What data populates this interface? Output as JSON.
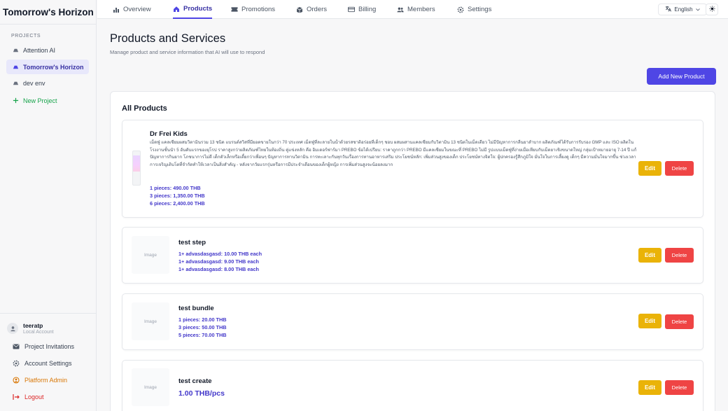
{
  "brand": "Tomorrow's Horizon",
  "sidebar": {
    "section_label": "PROJECTS",
    "projects": [
      {
        "label": "Attention AI"
      },
      {
        "label": "Tomorrow's Horizon"
      },
      {
        "label": "dev env"
      }
    ],
    "new_project": "New Project",
    "user": {
      "name": "teeratp",
      "sub": "Local Account"
    },
    "links": {
      "invitations": "Project Invitations",
      "settings": "Account Settings",
      "admin": "Platform Admin",
      "logout": "Logout"
    }
  },
  "nav": {
    "tabs": [
      {
        "label": "Overview"
      },
      {
        "label": "Products"
      },
      {
        "label": "Promotions"
      },
      {
        "label": "Orders"
      },
      {
        "label": "Billing"
      },
      {
        "label": "Members"
      },
      {
        "label": "Settings"
      }
    ],
    "active": "Products",
    "language": "English"
  },
  "main": {
    "title": "Products and Services",
    "subtitle": "Manage product and service information that AI will use to respond",
    "add_button": "Add New Product",
    "list_title": "All Products",
    "edit_label": "Edit",
    "delete_label": "Delete",
    "image_placeholder": "Image",
    "products": [
      {
        "name": "Dr Frei Kids",
        "description": "เม็ดฟู่ แคลเซียมผสมวิตามินรวม 13 ชนิด แบรนด์สวิสที่มียอดขายในกว่า 70 ประเทศ เม็ดฟู่ที่ละลายในน้ำด้วยรสชาติอร่อยที่เด็กๆ ชอบ ผสมผสานแคลเซียมกับวิตามิน 13 ชนิดในเม็ดเดียว ไม่มีปัญหาการกลืนยาลำบาก ผลิตภัณฑ์ได้รับการรับรอง GMP และ ISO ผลิตในโรงงานชั้นนำ 5 อันดับแรกของยุโรป ราคาสูงกว่าผลิตภัณฑ์ไทยในท้องถิ่น คู่แข่งหลัก คือ อิมเดอร์ฟาร์มา PREBO ข้อได้เปรียบ: ราคาถูกกว่า PREBO มีแคลเซียมในขณะที่ PREBO ไม่มี รูปแบบเม็ดฟู่ที่ง่ายเมื่อเทียบกับเม็ดยาเชิงขนาดใหญ่ กลุ่มเป้าหมายอายุ 7-14 ปี แก้ปัญหาการกินยาก โภชนาการไม่ดี เด็กตัวเล็กหรือเตี้ยกว่าเพื่อนๆ ปัญหาการทานวิตามิน การทะเลาะกันทุกวันเรื่องการทานอาหารเสริม ประโยชน์หลัก: เพิ่มส่วนสูงของเด็ก ประโยชน์ทางจิตใจ: ผู้ปกครองรู้สึกภูมิใจ มั่นใจในการเลี้ยงดู เด็กๆ มีความมั่นใจมากขึ้น ช่วงเวลาการเจริญเติบโตที่จำกัดทำให้เวลาเป็นสิ่งสำคัญ - หลังจากวัยแรกรุ่นหรือการมีประจำเดือนของเด็กผู้หญิง การเพิ่มส่วนสูงจะน้อยลงมาก",
        "prices": [
          "1 pieces: 490.00 THB",
          "3 pieces: 1,350.00 THB",
          "6 pieces: 2,400.00 THB"
        ]
      },
      {
        "name": "test step",
        "prices": [
          "1+ advasdasgasd: 10.00 THB each",
          "1+ advasdasgasd: 9.00 THB each",
          "1+ advasdasgasd: 8.00 THB each"
        ]
      },
      {
        "name": "test bundle",
        "prices": [
          "1 pieces: 20.00 THB",
          "3 pieces: 50.00 THB",
          "5 pieces: 70.00 THB"
        ]
      },
      {
        "name": "test create",
        "price": "1.00 THB/pcs"
      }
    ]
  },
  "colors": {
    "accent": "#4f46e5",
    "edit": "#eab308",
    "delete": "#ef4444",
    "price": "#4338ca",
    "new_project": "#16a34a",
    "admin": "#d97706",
    "logout": "#dc2626"
  }
}
